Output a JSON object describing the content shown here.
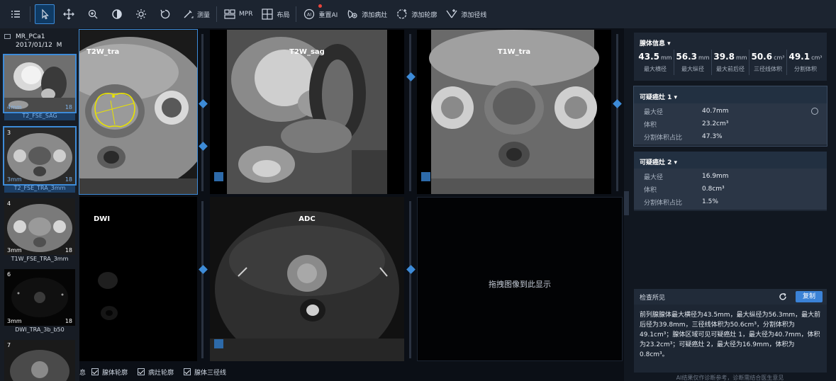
{
  "toolbar": {
    "tools": [
      {
        "icon": "list-icon"
      },
      {
        "icon": "pointer-icon",
        "active": true
      },
      {
        "icon": "pan-icon"
      },
      {
        "icon": "zoom-icon"
      },
      {
        "icon": "contrast-icon"
      },
      {
        "icon": "brightness-icon"
      },
      {
        "icon": "rotate-icon"
      },
      {
        "icon": "measure-icon",
        "label": "测量"
      },
      {
        "icon": "mpr-icon",
        "label": "MPR"
      },
      {
        "icon": "layout-icon",
        "label": "布局"
      },
      {
        "icon": "ai-icon",
        "label": "重置AI"
      },
      {
        "icon": "add-lesion-icon",
        "label": "添加病灶"
      },
      {
        "icon": "add-contour-icon",
        "label": "添加轮廓"
      },
      {
        "icon": "add-diameter-icon",
        "label": "添加径线"
      }
    ]
  },
  "series_panel": {
    "patient": "MR_PCa1",
    "date": "2017/01/12",
    "sex": "M",
    "thumbnails": [
      {
        "num": "",
        "size": "4mm",
        "count": "18",
        "label": "T2_FSE_SAG",
        "selected": true
      },
      {
        "num": "3",
        "size": "3mm",
        "count": "18",
        "label": "T2_FSE_TRA_3mm",
        "selected": true
      },
      {
        "num": "4",
        "size": "3mm",
        "count": "18",
        "label": "T1W_FSE_TRA_3mm",
        "selected": false
      },
      {
        "num": "6",
        "size": "3mm",
        "count": "18",
        "label": "DWI_TRA_3b_b50",
        "selected": false
      },
      {
        "num": "7",
        "size": "",
        "count": "",
        "label": "",
        "selected": false
      }
    ]
  },
  "viewports": {
    "v1": {
      "title": "T2W_tra"
    },
    "v2": {
      "title": "T2W_sag"
    },
    "v3": {
      "title": "T1W_tra"
    },
    "v4": {
      "title": "DWI"
    },
    "v5": {
      "title": "ADC"
    },
    "v6": {
      "empty_text": "拖拽图像到此显示"
    }
  },
  "bottombar": {
    "items": [
      {
        "label": "息",
        "partial": true
      },
      {
        "label": "腺体轮廓",
        "checked": true
      },
      {
        "label": "病灶轮廓",
        "checked": true
      },
      {
        "label": "腺体三径线",
        "checked": true
      }
    ]
  },
  "gland_info": {
    "title": "腺体信息",
    "metrics": [
      {
        "value": "43.5",
        "unit": "mm",
        "label": "最大横径"
      },
      {
        "value": "56.3",
        "unit": "mm",
        "label": "最大纵径"
      },
      {
        "value": "39.8",
        "unit": "mm",
        "label": "最大前后径"
      },
      {
        "value": "50.6",
        "unit": "cm³",
        "label": "三径线体积"
      },
      {
        "value": "49.1",
        "unit": "cm³",
        "label": "分割体积"
      }
    ]
  },
  "lesions": [
    {
      "title": "可疑癌灶 1",
      "rows": [
        {
          "k": "最大径",
          "v": "40.7mm"
        },
        {
          "k": "体积",
          "v": "23.2cm³"
        },
        {
          "k": "分割体积占比",
          "v": "47.3%"
        }
      ]
    },
    {
      "title": "可疑癌灶 2",
      "rows": [
        {
          "k": "最大径",
          "v": "16.9mm"
        },
        {
          "k": "体积",
          "v": "0.8cm³"
        },
        {
          "k": "分割体积占比",
          "v": "1.5%"
        }
      ]
    }
  ],
  "findings": {
    "title": "检查所见",
    "copy_label": "复制",
    "text": "前列腺腺体最大横径为43.5mm，最大纵径为56.3mm，最大前后径为39.8mm，三径线体积为50.6cm³，分割体积为49.1cm³；腺体区域可见可疑癌灶 1，最大径为40.7mm，体积为23.2cm³；可疑癌灶 2，最大径为16.9mm，体积为0.8cm³。"
  },
  "disclaimer": "AI结果仅作诊断参考，诊断需结合医生意见",
  "colors": {
    "accent": "#3d8bd8",
    "contour": "#e8e200"
  }
}
